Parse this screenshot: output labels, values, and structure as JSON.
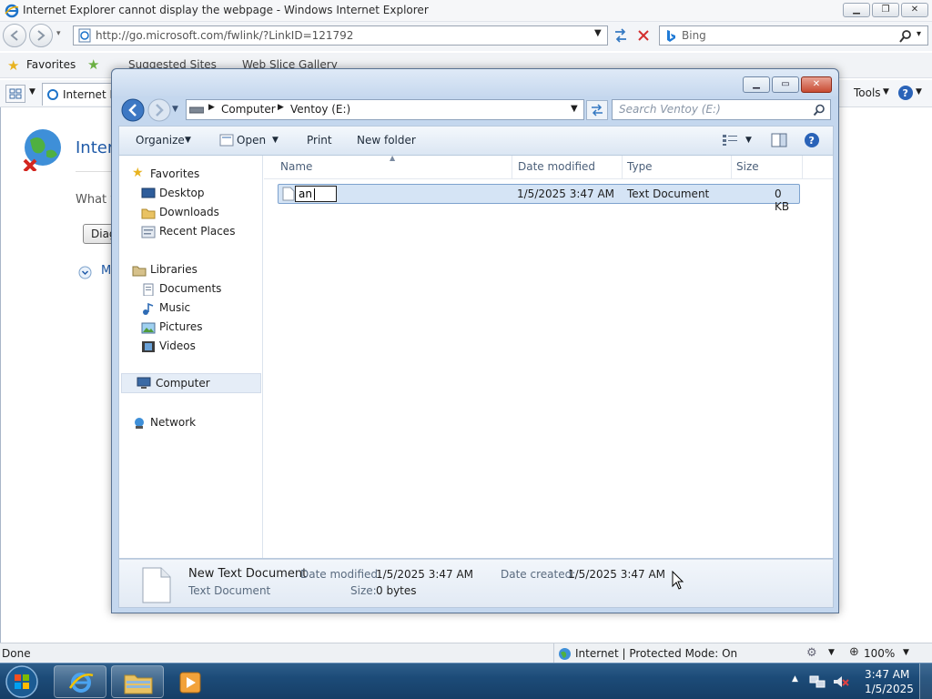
{
  "ie": {
    "window_title": "Internet Explorer cannot display the webpage - Windows Internet Explorer",
    "url": "http://go.microsoft.com/fwlink/?LinkID=121792",
    "search_placeholder": "Bing",
    "favorites_label": "Favorites",
    "suggested_sites": "Suggested Sites",
    "web_slice_gallery": "Web Slice Gallery",
    "tab_label": "Internet Ex",
    "tools_label": "Tools",
    "content_heading": "Interne",
    "content_text": "What y",
    "diagnose_button": "Diag",
    "more_info": "M",
    "status_left": "Done",
    "status_zone": "Internet | Protected Mode: On",
    "zoom": "100%"
  },
  "explorer": {
    "breadcrumb": [
      "Computer",
      "Ventoy (E:)"
    ],
    "search_placeholder": "Search Ventoy (E:)",
    "toolbar": {
      "organize": "Organize",
      "open": "Open",
      "print": "Print",
      "new_folder": "New folder"
    },
    "nav": {
      "favorites": "Favorites",
      "desktop": "Desktop",
      "downloads": "Downloads",
      "recent_places": "Recent Places",
      "libraries": "Libraries",
      "documents": "Documents",
      "music": "Music",
      "pictures": "Pictures",
      "videos": "Videos",
      "computer": "Computer",
      "network": "Network"
    },
    "columns": {
      "name": "Name",
      "date_modified": "Date modified",
      "type": "Type",
      "size": "Size"
    },
    "file": {
      "rename_value": "an",
      "date_modified": "1/5/2025 3:47 AM",
      "type": "Text Document",
      "size": "0 KB"
    },
    "details": {
      "name": "New Text Document",
      "type": "Text Document",
      "date_modified_label": "Date modified:",
      "date_modified": "1/5/2025 3:47 AM",
      "date_created_label": "Date created:",
      "date_created": "1/5/2025 3:47 AM",
      "size_label": "Size:",
      "size": "0 bytes"
    }
  },
  "taskbar": {
    "time": "3:47 AM",
    "date": "1/5/2025"
  }
}
